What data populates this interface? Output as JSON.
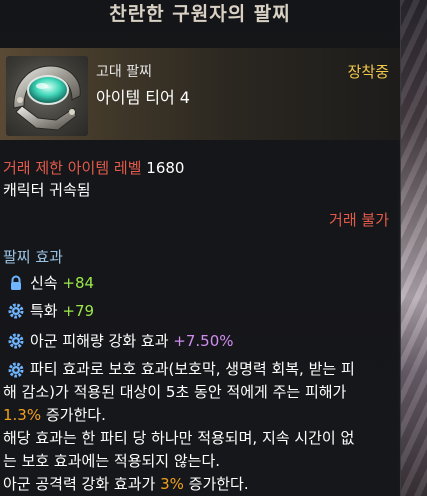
{
  "tooltip": {
    "title": "찬란한 구원자의 팔찌",
    "grade": "고대 팔찌",
    "tier": "아이템 티어 4",
    "equipped": "장착중",
    "trade_level_label": "거래 제한 아이템 레벨",
    "trade_level_value": "1680",
    "bound": "캐릭터 귀속됨",
    "no_trade": "거래 불가",
    "effects_header": "팔찌 효과",
    "stats": [
      {
        "icon": "lock-icon",
        "name": "신속",
        "value": "+84"
      },
      {
        "icon": "gear-icon",
        "name": "특화",
        "value": "+79"
      },
      {
        "icon": "gear-icon",
        "name": "아군 피해량 강화 효과",
        "value": "+7.50%"
      }
    ],
    "special": {
      "icon": "gear-icon",
      "line1": "파티 효과로 보호 효과(보호막, 생명력 회복, 받는 피",
      "line2": "해 감소)가 적용된 대상이 5초 동안 적에게 주는 피해가",
      "pct1": "1.3%",
      "line3_rest": " 증가한다.",
      "line4": "해당 효과는 한 파티 당 하나만 적용되며, 지속 시간이 없",
      "line5": "는 보호 효과에는 적용되지 않는다.",
      "line6_pre": "아군 공격력 강화 효과가 ",
      "pct2": "3%",
      "line6_post": " 증가한다."
    }
  },
  "colors": {
    "equipped": "#f0c84a",
    "warning": "#e25a4a",
    "effect_header": "#9bc3e6",
    "stat_value": "#9be84a",
    "percent_value": "#d08cf0",
    "highlight": "#f0a020"
  }
}
